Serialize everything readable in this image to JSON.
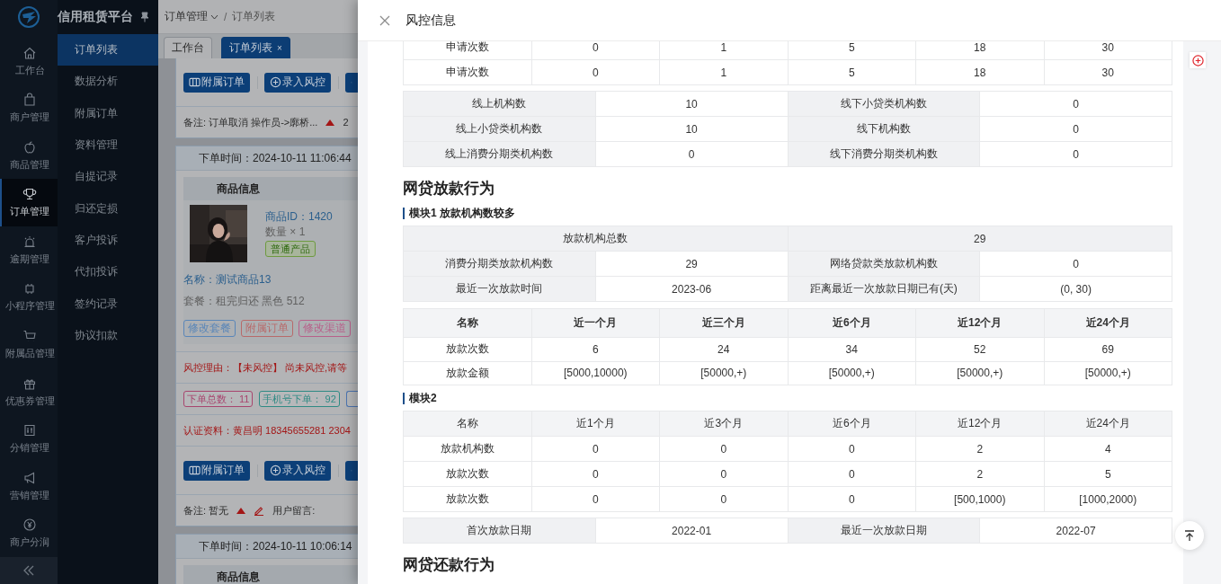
{
  "sidebar": {
    "brand": "信用租赁平台",
    "rail": [
      {
        "label": "工作台",
        "selected": false
      },
      {
        "label": "商户管理",
        "selected": false
      },
      {
        "label": "商品管理",
        "selected": false
      },
      {
        "label": "订单管理",
        "selected": true
      },
      {
        "label": "逾期管理",
        "selected": false
      },
      {
        "label": "小程序管理",
        "selected": false
      },
      {
        "label": "附属品管理",
        "selected": false
      },
      {
        "label": "优惠券管理",
        "selected": false
      },
      {
        "label": "分销管理",
        "selected": false
      },
      {
        "label": "营销管理",
        "selected": false
      },
      {
        "label": "商户分润",
        "selected": false
      }
    ],
    "submenu": [
      {
        "label": "订单列表",
        "selected": true
      },
      {
        "label": "数据分析",
        "selected": false
      },
      {
        "label": "附属订单",
        "selected": false
      },
      {
        "label": "资料管理",
        "selected": false
      },
      {
        "label": "自提记录",
        "selected": false
      },
      {
        "label": "归还定损",
        "selected": false
      },
      {
        "label": "客户投诉",
        "selected": false
      },
      {
        "label": "代扣投诉",
        "selected": false
      },
      {
        "label": "签约记录",
        "selected": false
      },
      {
        "label": "协议扣款",
        "selected": false
      }
    ]
  },
  "breadcrumb": {
    "items": [
      "订单管理",
      "订单列表"
    ],
    "separator": "/"
  },
  "tabs": [
    {
      "label": "工作台",
      "selected": false
    },
    {
      "label": "订单列表",
      "selected": true,
      "close": "×"
    }
  ],
  "orders": [
    {
      "actions": [
        {
          "kind": "button",
          "label": "附属订单"
        },
        {
          "kind": "button",
          "label": "录入风控"
        },
        {
          "kind": "cut"
        }
      ],
      "remark": "备注: 订单取消 操作员->廓桥...",
      "remark_extra": "2"
    },
    {
      "order_time": "下单时间：2024-10-11 11:06:44",
      "product": {
        "header": "商品信息",
        "kind": "picture",
        "id": "商品ID：1420",
        "qty": "数量 × 1",
        "tag": "普通产品",
        "name": "名称：测试商品13",
        "plan": "套餐：租完归还 黑色 512",
        "buttons": [
          {
            "label": "修改套餐",
            "color": "#5a86b8"
          },
          {
            "label": "附属订单",
            "color": "#b86a6a"
          },
          {
            "label": "修改渠道",
            "color": "#b8608a"
          }
        ]
      },
      "risk": "风控理由：【未风控】 尚未风控,请等",
      "stats": [
        {
          "kind": "tag",
          "label": "下单总数：",
          "value": "11",
          "color": "#a8456e"
        },
        {
          "kind": "tag",
          "label": "手机号下单：",
          "value": "92",
          "color": "#2f8a84"
        },
        {
          "kind": "cut",
          "color": "#4d75b0"
        }
      ],
      "auth": "认证资料：黄昌明 18345655281 2304",
      "actions": [
        {
          "kind": "button",
          "label": "附属订单"
        },
        {
          "kind": "button",
          "label": "录入风控"
        },
        {
          "kind": "cut"
        }
      ],
      "remark": "备注: 暂无",
      "message": "用户留言:"
    },
    {
      "order_time": "下单时间：2024-10-11 10:06:14",
      "product": {
        "header": "商品信息"
      }
    }
  ],
  "drawer": {
    "title": "风控信息",
    "blocks": [
      {
        "kind": "grid",
        "rows": [
          [
            "申请次数",
            "0",
            "1",
            "5",
            "18",
            "30"
          ],
          [
            "申请次数",
            "0",
            "1",
            "5",
            "18",
            "30"
          ]
        ]
      },
      {
        "kind": "kv",
        "rows": [
          [
            [
              "线上机构数",
              "10"
            ],
            [
              "线下小贷类机构数",
              "0"
            ]
          ],
          [
            [
              "线上小贷类机构数",
              "10"
            ],
            [
              "线下机构数",
              "0"
            ]
          ],
          [
            [
              "线上消费分期类机构数",
              "0"
            ],
            [
              "线下消费分期类机构数",
              "0"
            ]
          ]
        ]
      },
      {
        "kind": "heading",
        "text": "网贷放款行为"
      },
      {
        "kind": "subheading",
        "text": "模块1 放款机构数较多"
      },
      {
        "kind": "kv",
        "rows": [
          [
            [
              "放款机构总数",
              "29"
            ]
          ],
          [
            [
              "消费分期类放款机构数",
              "29"
            ],
            [
              "网络贷款类放款机构数",
              "0"
            ]
          ],
          [
            [
              "最近一次放款时间",
              "2023-06"
            ],
            [
              "距离最近一次放款日期已有(天)",
              "(0, 30)"
            ]
          ]
        ]
      },
      {
        "kind": "grid",
        "bold_header": true,
        "columns": [
          "名称",
          "近一个月",
          "近三个月",
          "近6个月",
          "近12个月",
          "近24个月"
        ],
        "rows": [
          [
            "放款次数",
            "6",
            "24",
            "34",
            "52",
            "69"
          ],
          [
            "放款金额",
            "[5000,10000)",
            "[50000,+)",
            "[50000,+)",
            "[50000,+)",
            "[50000,+)"
          ]
        ]
      },
      {
        "kind": "subheading",
        "text": "模块2"
      },
      {
        "kind": "grid",
        "bold_header": false,
        "columns": [
          "名称",
          "近1个月",
          "近3个月",
          "近6个月",
          "近12个月",
          "近24个月"
        ],
        "rows": [
          [
            "放款机构数",
            "0",
            "0",
            "0",
            "2",
            "4"
          ],
          [
            "放款次数",
            "0",
            "0",
            "0",
            "2",
            "5"
          ],
          [
            "放款次数",
            "0",
            "0",
            "0",
            "[500,1000)",
            "[1000,2000)"
          ]
        ]
      },
      {
        "kind": "kv",
        "rows": [
          [
            [
              "首次放款日期",
              "2022-01"
            ],
            [
              "最近一次放款日期",
              "2022-07"
            ]
          ]
        ]
      },
      {
        "kind": "heading",
        "text": "网贷还款行为"
      }
    ]
  }
}
